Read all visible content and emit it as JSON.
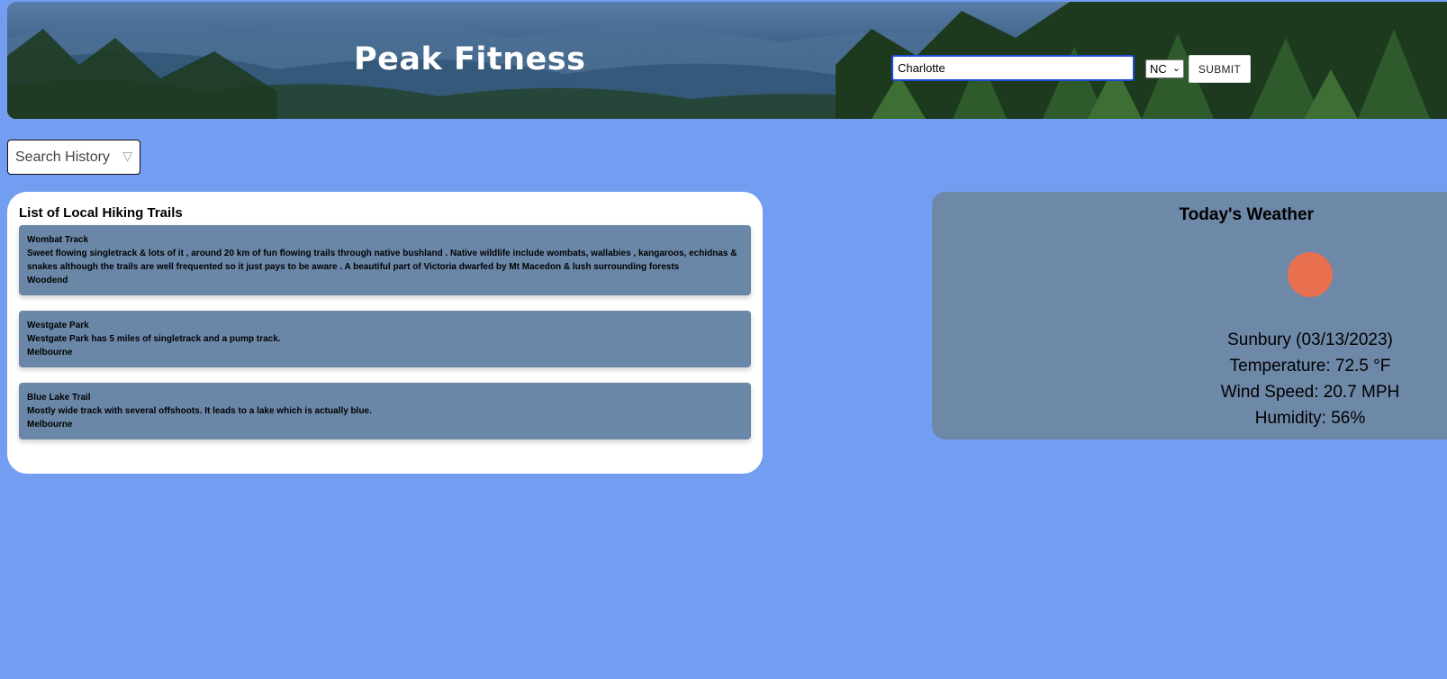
{
  "colors": {
    "page_bg": "#729df0",
    "card_bg": "#6b87a8",
    "weather_bg": "#6e88a8",
    "sun": "#e8704f"
  },
  "header": {
    "brand": "Peak Fitness"
  },
  "search": {
    "city_value": "Charlotte",
    "state_value": "NC",
    "submit_label": "SUBMIT"
  },
  "history": {
    "label": "Search History"
  },
  "trails": {
    "title": "List of Local Hiking Trails",
    "items": [
      {
        "name": "Wombat Track",
        "description": "Sweet flowing singletrack & lots of it , around 20 km of fun flowing trails through native bushland . Native wildlife include wombats, wallabies , kangaroos, echidnas & snakes although the trails are well frequented so it just pays to be aware . A beautiful part of Victoria dwarfed by Mt Macedon & lush surrounding forests",
        "location": "Woodend"
      },
      {
        "name": "Westgate Park",
        "description": "Westgate Park has 5 miles of singletrack and a pump track.",
        "location": "Melbourne"
      },
      {
        "name": "Blue Lake Trail",
        "description": "Mostly wide track with several offshoots. It leads to a lake which is actually blue.",
        "location": "Melbourne"
      }
    ]
  },
  "weather": {
    "title": "Today's Weather",
    "icon": "sun-icon",
    "city_date": "Sunbury (03/13/2023)",
    "temperature": "Temperature: 72.5 °F",
    "wind": "Wind Speed: 20.7 MPH",
    "humidity": "Humidity: 56%"
  }
}
